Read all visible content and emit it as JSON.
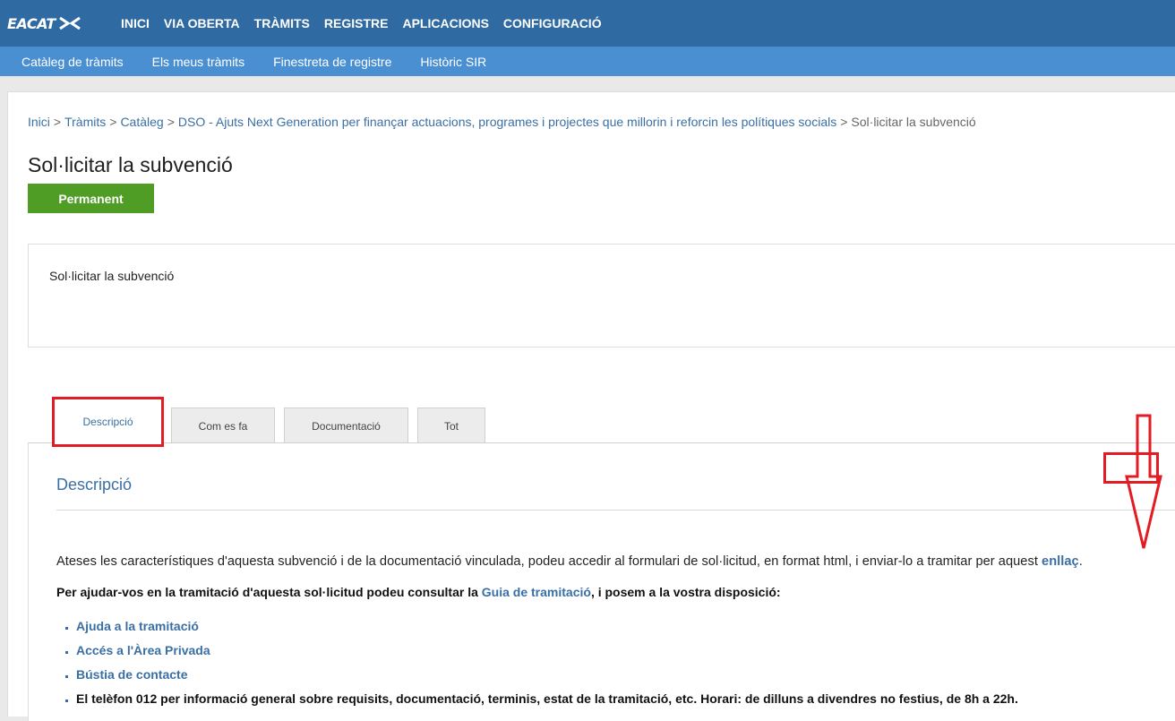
{
  "brand": {
    "logo_text": "EACAT"
  },
  "top_nav": {
    "items": [
      "INICI",
      "VIA OBERTA",
      "TRÀMITS",
      "REGISTRE",
      "APLICACIONS",
      "CONFIGURACIÓ"
    ]
  },
  "sub_nav": {
    "items": [
      "Catàleg de tràmits",
      "Els meus tràmits",
      "Finestreta de registre",
      "Històric SIR"
    ]
  },
  "breadcrumb": {
    "items": [
      "Inici",
      "Tràmits",
      "Catàleg",
      "DSO - Ajuts Next Generation per finançar actuacions, programes i projectes que millorin i reforcin les polítiques socials"
    ],
    "separator": ">",
    "current": "Sol·licitar la subvenció"
  },
  "page": {
    "title": "Sol·licitar la subvenció",
    "badge": "Permanent",
    "summary": "Sol·licitar la subvenció"
  },
  "tabs": [
    {
      "label": "Descripció",
      "active": true
    },
    {
      "label": "Com es fa",
      "active": false
    },
    {
      "label": "Documentació",
      "active": false
    },
    {
      "label": "Tot",
      "active": false
    }
  ],
  "content": {
    "section_title": "Descripció",
    "para1_text": "Ateses les característiques d'aquesta subvenció i de la documentació vinculada, podeu accedir al formulari de sol·licitud, en format html, i enviar-lo a tramitar per aquest ",
    "para1_link": "enllaç",
    "para1_end": ".",
    "para2_before": "Per ajudar-vos en la tramitació d'aquesta sol·licitud podeu consultar la ",
    "para2_link": "Guia de tramitació",
    "para2_after": ", i posem a la vostra disposició:",
    "help_items": [
      "Ajuda a la tramitació",
      "Accés a l'Àrea Privada",
      "Bústia de contacte",
      "El telèfon 012 per informació general sobre requisits, documentació, terminis, estat de la tramitació, etc. Horari: de dilluns a divendres no festius, de 8h a 22h."
    ]
  },
  "colors": {
    "top_bar": "#2f6aa3",
    "sub_bar": "#4a8fd1",
    "link": "#3a6fa4",
    "badge_green": "#4f9d24",
    "annotation_red": "#e31b23"
  },
  "icons": {
    "logo_mark": "chevron-pair",
    "annotation_arrow": "down-arrow-outline"
  }
}
